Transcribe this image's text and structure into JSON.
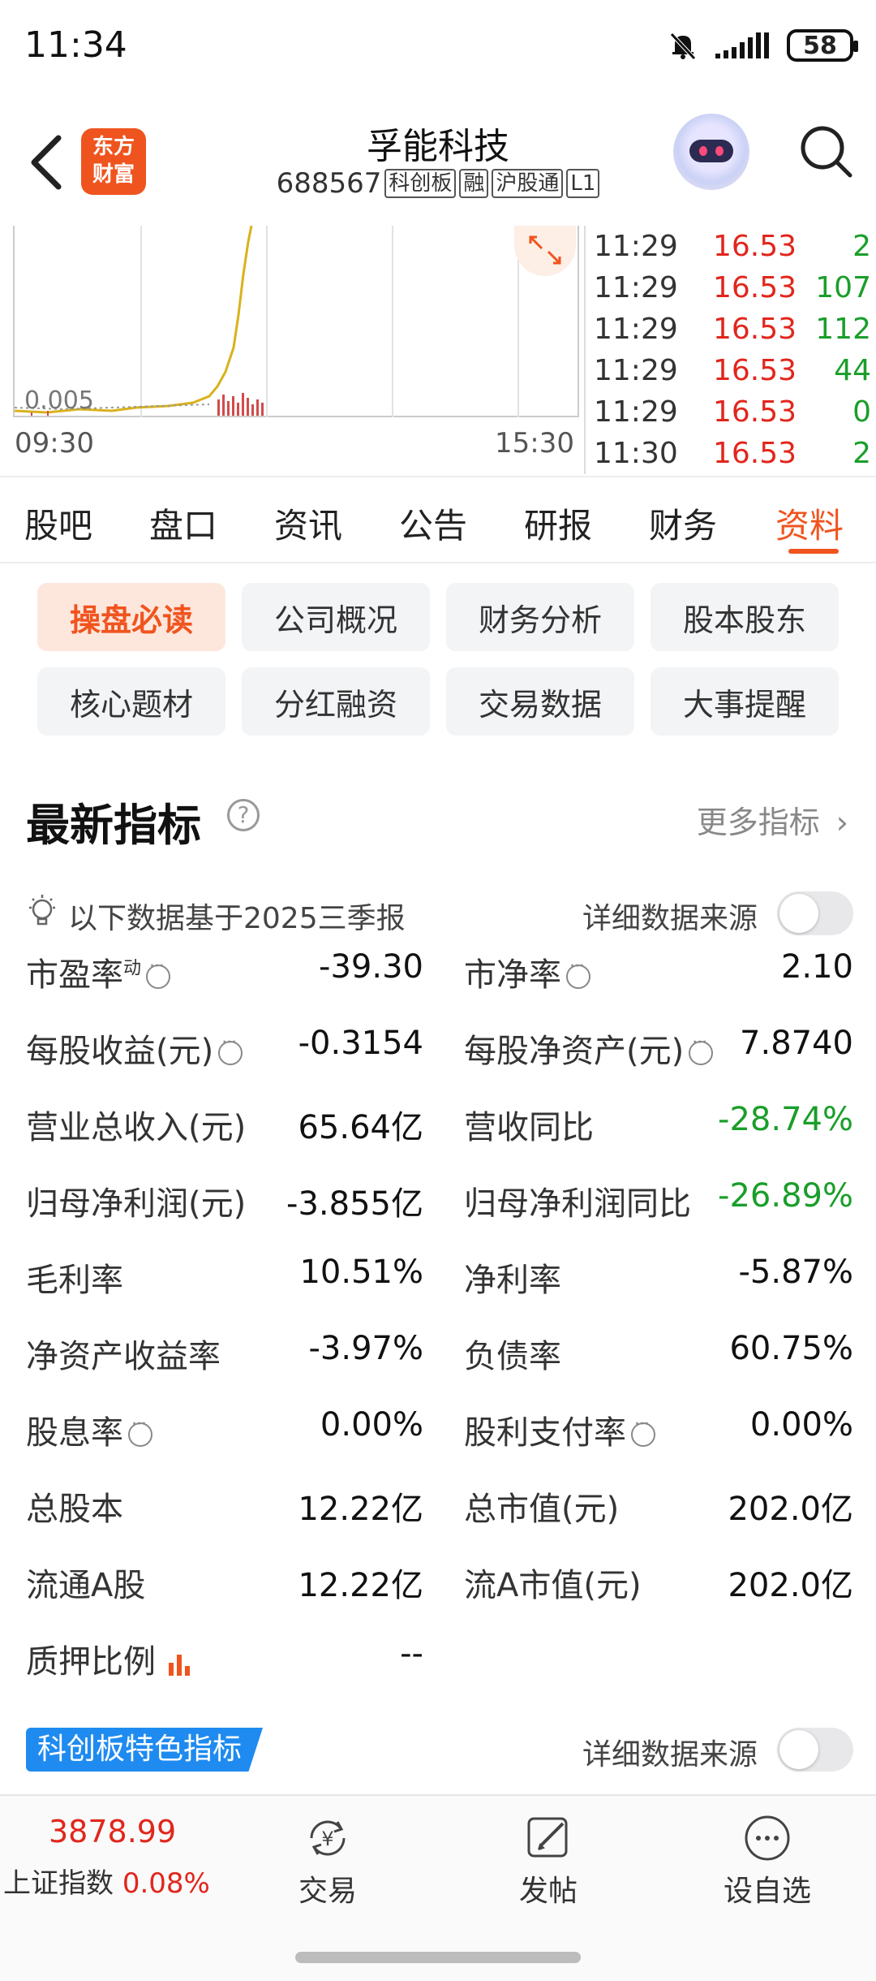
{
  "status": {
    "time": "11:34",
    "battery": "58"
  },
  "header": {
    "logo_line1": "东方",
    "logo_line2": "财富",
    "stock_name": "孚能科技",
    "stock_code": "688567",
    "tags": [
      "科创板",
      "融",
      "沪股通",
      "L1"
    ]
  },
  "chart": {
    "time_start": "09:30",
    "time_end": "15:30",
    "vol_label": "0.005"
  },
  "ticks": [
    {
      "time": "11:29",
      "price": "16.53",
      "vol": "2"
    },
    {
      "time": "11:29",
      "price": "16.53",
      "vol": "107"
    },
    {
      "time": "11:29",
      "price": "16.53",
      "vol": "112"
    },
    {
      "time": "11:29",
      "price": "16.53",
      "vol": "44"
    },
    {
      "time": "11:29",
      "price": "16.53",
      "vol": "0"
    },
    {
      "time": "11:30",
      "price": "16.53",
      "vol": "2"
    }
  ],
  "tabs": [
    "股吧",
    "盘口",
    "资讯",
    "公告",
    "研报",
    "财务",
    "资料"
  ],
  "subtabs": [
    "操盘必读",
    "公司概况",
    "财务分析",
    "股本股东",
    "核心题材",
    "分红融资",
    "交易数据",
    "大事提醒"
  ],
  "section": {
    "title": "最新指标",
    "help": "?",
    "more": "更多指标",
    "basis": "以下数据基于2025三季报",
    "source": "详细数据来源"
  },
  "metrics": [
    {
      "l_label": "市盈率",
      "l_sup": "动",
      "l_val": "-39.30",
      "r_label": "市净率",
      "r_val": "2.10"
    },
    {
      "l_label": "每股收益(元)",
      "l_val": "-0.3154",
      "r_label": "每股净资产(元)",
      "r_val": "7.8740"
    },
    {
      "l_label": "营业总收入(元)",
      "l_val": "65.64亿",
      "r_label": "营收同比",
      "r_val": "-28.74%"
    },
    {
      "l_label": "归母净利润(元)",
      "l_val": "-3.855亿",
      "r_label": "归母净利润同比",
      "r_val": "-26.89%"
    },
    {
      "l_label": "毛利率",
      "l_val": "10.51%",
      "r_label": "净利率",
      "r_val": "-5.87%"
    },
    {
      "l_label": "净资产收益率",
      "l_val": "-3.97%",
      "r_label": "负债率",
      "r_val": "60.75%"
    },
    {
      "l_label": "股息率",
      "l_val": "0.00%",
      "r_label": "股利支付率",
      "r_val": "0.00%"
    },
    {
      "l_label": "总股本",
      "l_val": "12.22亿",
      "r_label": "总市值(元)",
      "r_val": "202.0亿"
    },
    {
      "l_label": "流通A股",
      "l_val": "12.22亿",
      "r_label": "流A市值(元)",
      "r_val": "202.0亿"
    },
    {
      "l_label": "质押比例",
      "l_val": "--"
    }
  ],
  "kcb": {
    "badge": "科创板特色指标",
    "source": "详细数据来源"
  },
  "bottom": {
    "index_value": "3878.99",
    "index_name": "上证指数",
    "index_pct": "0.08%",
    "nav": [
      "交易",
      "发帖",
      "设自选"
    ]
  },
  "colors": {
    "accent": "#f0541e",
    "up": "#e1261c",
    "down": "#1a9e2a",
    "badge": "#1f8bf0"
  }
}
